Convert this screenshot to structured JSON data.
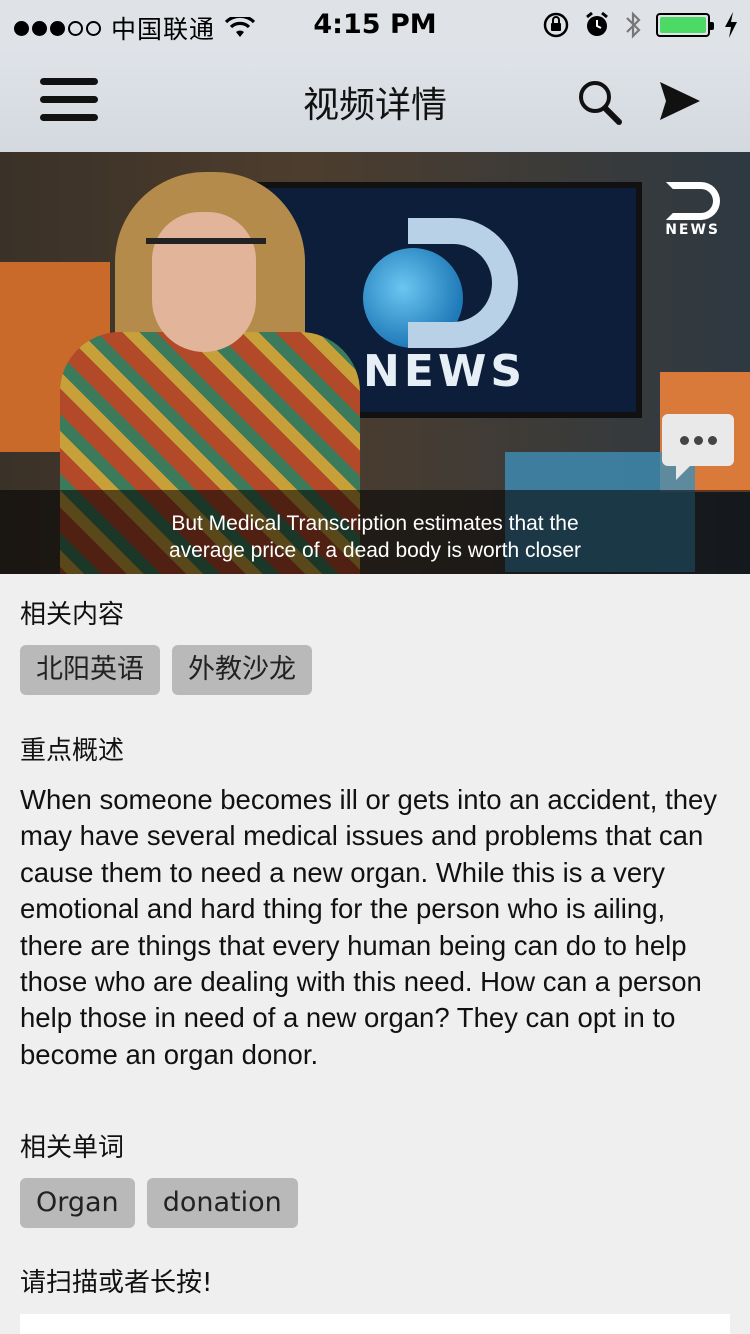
{
  "status_bar": {
    "carrier": "中国联通",
    "time": "4:15 PM"
  },
  "nav": {
    "title": "视频详情",
    "icons": [
      "menu-icon",
      "search-icon",
      "send-icon"
    ]
  },
  "video": {
    "screen_logo": "NEWS",
    "corner_logo": "NEWS",
    "subtitle_line1": "But Medical Transcription estimates that the",
    "subtitle_line2": "average price of a dead body is worth closer"
  },
  "related": {
    "title": "相关内容",
    "tags": [
      "北阳英语",
      "外教沙龙"
    ]
  },
  "summary": {
    "title": "重点概述",
    "text": "When someone becomes ill or gets into an accident, they may have several medical issues and problems that  can cause them to need a new organ. While this is a very emotional and hard thing for the person who is ailing,  there are things that every human being can do to help those who are dealing with this need. How can a person help those in need of a new organ? They can opt in to become an organ donor."
  },
  "words": {
    "title": "相关单词",
    "tags": [
      "Organ",
      "donation"
    ]
  },
  "scan": {
    "title": "请扫描或者长按!"
  },
  "colors": {
    "battery": "#4cd964",
    "tag_bg": "#b9b9b9",
    "nav_bg": "#dfe3e8"
  }
}
